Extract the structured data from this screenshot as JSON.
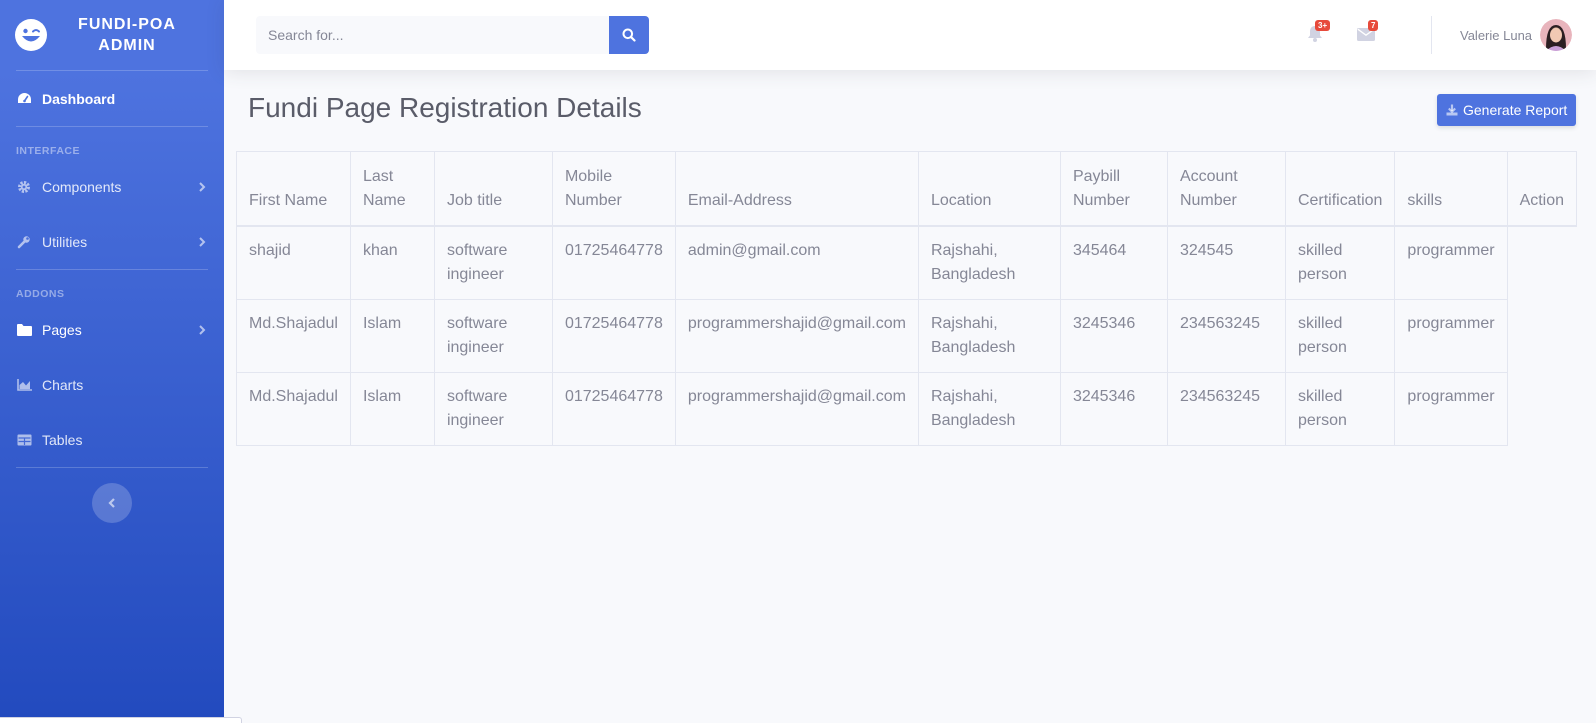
{
  "brand": {
    "line1": "FUNDI-POA",
    "line2": "ADMIN"
  },
  "sidebar": {
    "dashboard": "Dashboard",
    "heading_interface": "INTERFACE",
    "components": "Components",
    "utilities": "Utilities",
    "heading_addons": "ADDONS",
    "pages": "Pages",
    "charts": "Charts",
    "tables": "Tables"
  },
  "topbar": {
    "search_placeholder": "Search for...",
    "alerts_badge": "3+",
    "messages_badge": "7",
    "user_name": "Valerie Luna"
  },
  "page": {
    "title": "Fundi Page Registration Details",
    "report_button": "Generate Report"
  },
  "table": {
    "headers": [
      "First Name",
      "Last Name",
      "Job title",
      "Mobile Number",
      "Email-Address",
      "Location",
      "Paybill Number",
      "Account Number",
      "Certification",
      "skills",
      "Action"
    ],
    "rows": [
      [
        "shajid",
        "khan",
        "software ingineer",
        "01725464778",
        "admin@gmail.com",
        "Rajshahi, Bangladesh",
        "345464",
        "324545",
        "skilled person",
        "programmer"
      ],
      [
        "Md.Shajadul",
        "Islam",
        "software ingineer",
        "01725464778",
        "programmershajid@gmail.com",
        "Rajshahi, Bangladesh",
        "3245346",
        "234563245",
        "skilled person",
        "programmer"
      ],
      [
        "Md.Shajadul",
        "Islam",
        "software ingineer",
        "01725464778",
        "programmershajid@gmail.com",
        "Rajshahi, Bangladesh",
        "3245346",
        "234563245",
        "skilled person",
        "programmer"
      ]
    ]
  },
  "colors": {
    "primary": "#4e73df",
    "primary_dark": "#224abe",
    "danger": "#e74a3b",
    "text": "#858796",
    "title": "#5a5c69"
  }
}
